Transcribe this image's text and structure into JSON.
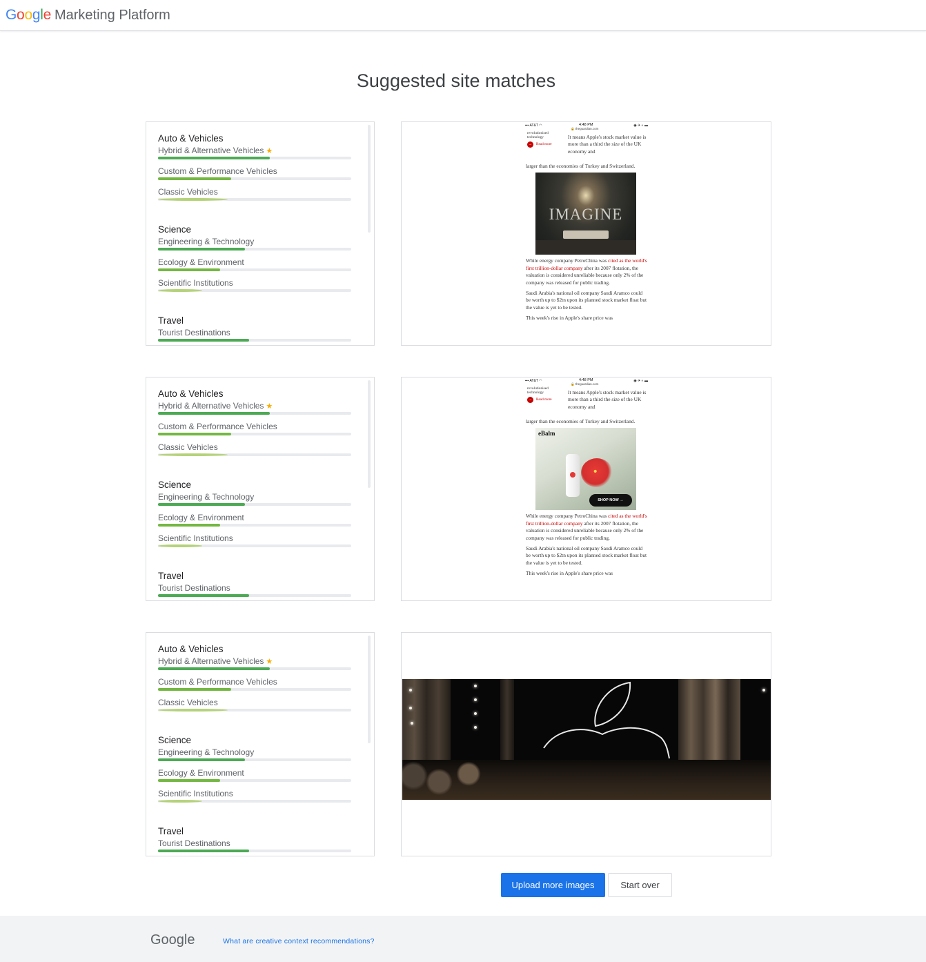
{
  "header": {
    "brand_logo": "Google",
    "product_name": "Marketing Platform"
  },
  "page_title": "Suggested site matches",
  "categories_sections": [
    {
      "title": "Auto & Vehicles",
      "items": [
        {
          "label": "Hybrid & Alternative Vehicles",
          "starred": true,
          "score_pct": 58,
          "shade": "dark"
        },
        {
          "label": "Custom & Performance Vehicles",
          "starred": false,
          "score_pct": 38,
          "shade": "mid"
        },
        {
          "label": "Classic Vehicles",
          "starred": false,
          "score_pct": 36,
          "shade": "light"
        }
      ]
    },
    {
      "title": "Science",
      "items": [
        {
          "label": "Engineering & Technology",
          "starred": false,
          "score_pct": 45,
          "shade": "dark"
        },
        {
          "label": "Ecology & Environment",
          "starred": false,
          "score_pct": 32,
          "shade": "mid"
        },
        {
          "label": "Scientific Institutions",
          "starred": false,
          "score_pct": 23,
          "shade": "light"
        }
      ]
    },
    {
      "title": "Travel",
      "items": [
        {
          "label": "Tourist Destinations",
          "starred": false,
          "score_pct": 47,
          "shade": "dark"
        }
      ]
    }
  ],
  "previews": [
    {
      "type": "article",
      "status": {
        "carrier": "AT&T",
        "time": "4:48 PM",
        "url": "theguardian.com"
      },
      "aside": {
        "text": "revolutionised technology",
        "link": "Read more"
      },
      "intro": "It means Apple's stock market value is more than a third the size of the UK economy and",
      "continued": "larger than the economies of Turkey and Switzerland.",
      "ad": {
        "kind": "interior",
        "headline": "IMAGINE"
      },
      "para1_before": "While energy company PetroChina was ",
      "para1_link": "cited as the world's first trillion-dollar company",
      "para1_after": " after its 2007 flotation, the valuation is considered unreliable because only 2% of the company was released for public trading.",
      "para2": "Saudi Arabia's national oil company Saudi Aramco could be worth up to $2tn upon its planned stock market float but the value is yet to be tested.",
      "para3": "This week's rise in Apple's share price was"
    },
    {
      "type": "article",
      "status": {
        "carrier": "AT&T",
        "time": "4:48 PM",
        "url": "theguardian.com"
      },
      "aside": {
        "text": "revolutionised technology",
        "link": "Read more"
      },
      "intro": "It means Apple's stock market value is more than a third the size of the UK economy and",
      "continued": "larger than the economies of Turkey and Switzerland.",
      "ad": {
        "kind": "product",
        "brand": "eBalm",
        "cta": "SHOP NOW"
      },
      "para1_before": "While energy company PetroChina was ",
      "para1_link": "cited as the world's first trillion-dollar company",
      "para1_after": " after its 2007 flotation, the valuation is considered unreliable because only 2% of the company was released for public trading.",
      "para2": "Saudi Arabia's national oil company Saudi Aramco could be worth up to $2tn upon its planned stock market float but the value is yet to be tested.",
      "para3": "This week's rise in Apple's share price was"
    },
    {
      "type": "photo",
      "description_icon": "apple-logo-icon"
    }
  ],
  "actions": {
    "upload_label": "Upload more images",
    "start_over_label": "Start over"
  },
  "footer": {
    "logo": "Google",
    "link_label": "What are creative context recommendations?"
  },
  "colors": {
    "primary": "#1a73e8",
    "bar_dark": "#4caa54",
    "bar_mid": "#74b843",
    "bar_light": "#b5d27a",
    "star": "#f9ab00"
  }
}
